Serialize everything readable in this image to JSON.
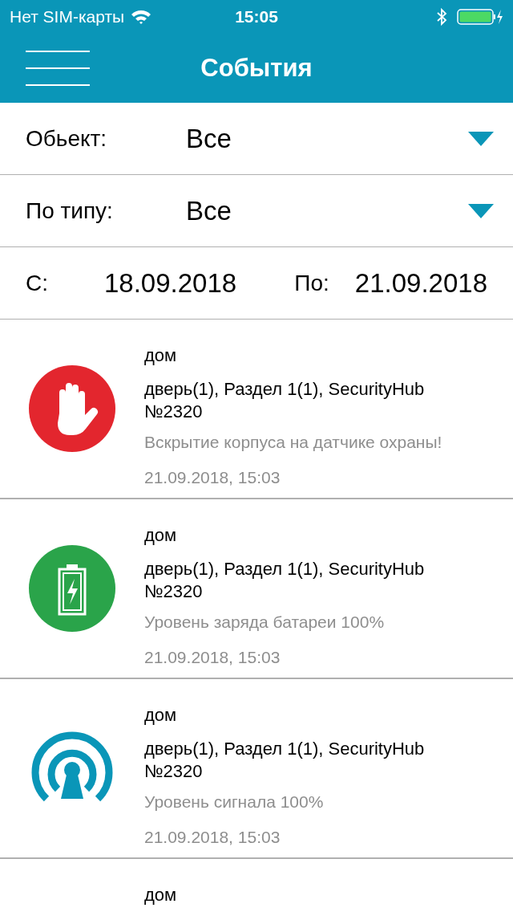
{
  "status_bar": {
    "carrier": "Нет SIM-карты",
    "time": "15:05"
  },
  "header": {
    "title": "События"
  },
  "filters": [
    {
      "label": "Обьект:",
      "value": "Все"
    },
    {
      "label": "По типу:",
      "value": "Все"
    }
  ],
  "dates": {
    "from_label": "С:",
    "from": "18.09.2018",
    "to_label": "По:",
    "to": "21.09.2018"
  },
  "events": [
    {
      "kind": "alarm",
      "color": "#e3262e",
      "title": "дом",
      "source": "дверь(1), Раздел 1(1), SecurityHub №2320",
      "message": "Вскрытие корпуса на датчике охраны!",
      "time": "21.09.2018, 15:03"
    },
    {
      "kind": "battery",
      "color": "#2aa44a",
      "title": "дом",
      "source": "дверь(1), Раздел 1(1), SecurityHub №2320",
      "message": "Уровень заряда батареи 100%",
      "time": "21.09.2018, 15:03"
    },
    {
      "kind": "signal",
      "color": "#0a96b8",
      "title": "дом",
      "source": "дверь(1), Раздел 1(1), SecurityHub №2320",
      "message": "Уровень сигнала 100%",
      "time": "21.09.2018, 15:03"
    },
    {
      "title": "дом"
    }
  ]
}
